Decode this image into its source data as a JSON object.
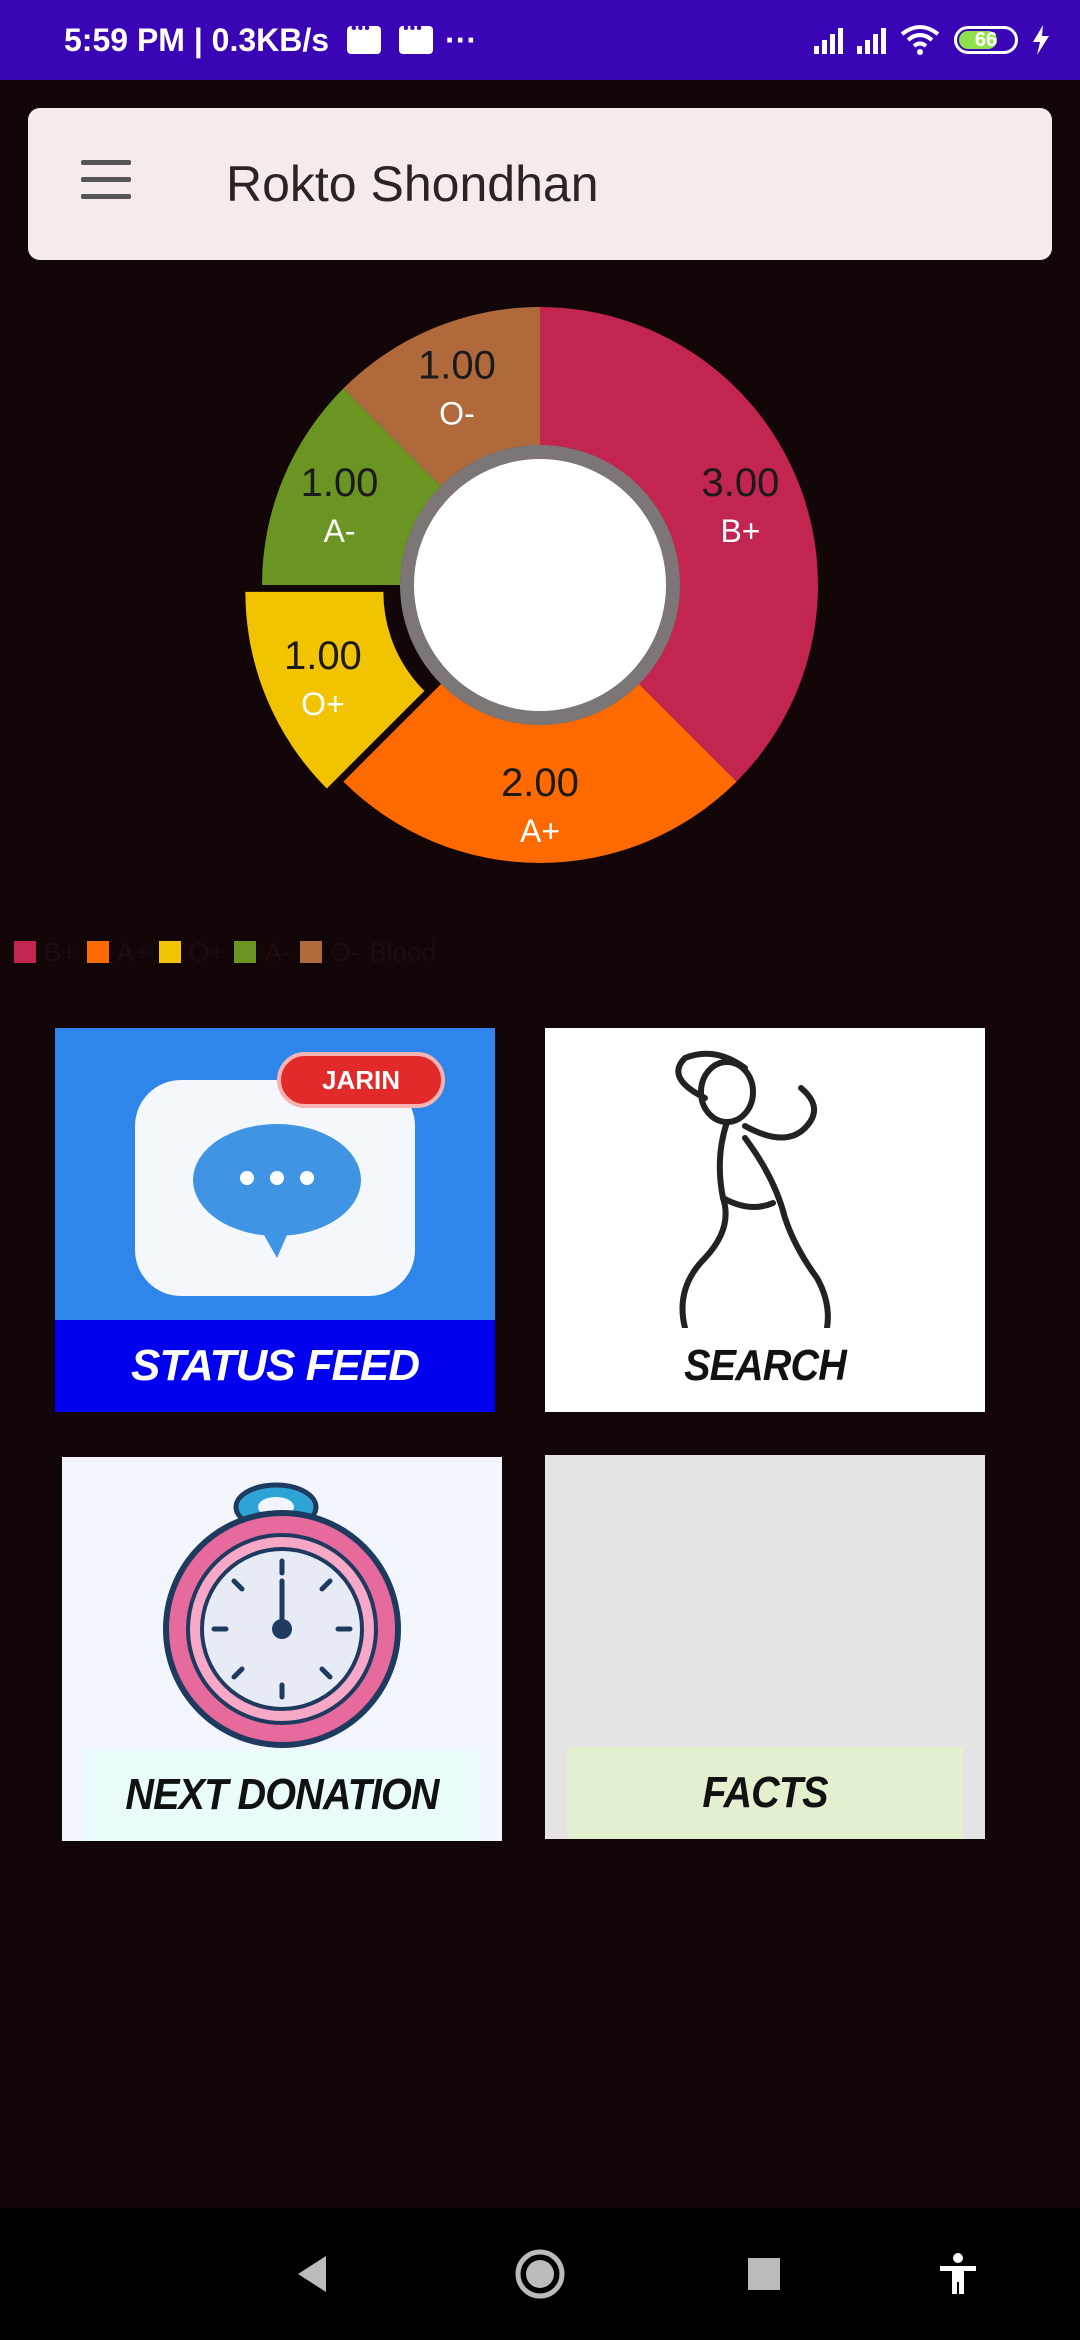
{
  "status_bar": {
    "time_speed": "5:59 PM | 0.3KB/s",
    "more": "···",
    "battery": "66"
  },
  "app_bar": {
    "title": "Rokto Shondhan"
  },
  "chart_data": {
    "type": "pie",
    "donut": true,
    "categories": [
      "B+",
      "A+",
      "O+",
      "A-",
      "O-"
    ],
    "values": [
      3.0,
      2.0,
      1.0,
      1.0,
      1.0
    ],
    "value_labels": [
      "3.00",
      "2.00",
      "1.00",
      "1.00",
      "1.00"
    ],
    "colors": [
      "#c2254f",
      "#ff6a00",
      "#f2c300",
      "#6a9522",
      "#b0693a"
    ],
    "legend": [
      "B+",
      "A+",
      "O+",
      "A-",
      "O-"
    ],
    "legend_title": "Blood",
    "legend_placement": "bottom-left",
    "highlighted": "O+"
  },
  "tiles": {
    "status_feed": {
      "caption": "STATUS FEED",
      "badge": "JARIN"
    },
    "search": {
      "caption": "SEARCH"
    },
    "next_donation": {
      "caption": "NEXT DONATION"
    },
    "facts": {
      "caption": "FACTS"
    }
  }
}
